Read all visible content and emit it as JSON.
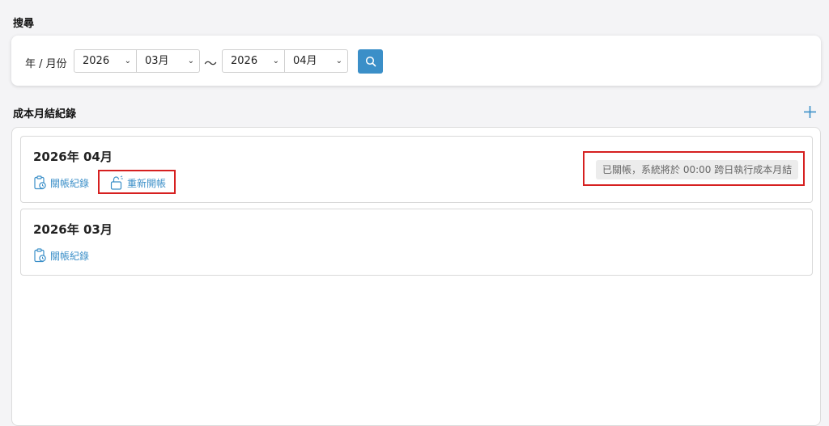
{
  "search": {
    "title": "搜尋",
    "label": "年 / 月份",
    "from_year": "2026",
    "from_month": "03月",
    "separator": "～",
    "to_year": "2026",
    "to_month": "04月"
  },
  "records": {
    "title": "成本月結紀錄",
    "items": [
      {
        "title": "2026年 04月",
        "log_label": "關帳紀錄",
        "reopen_label": "重新開帳",
        "status": "已關帳，系統將於 00:00 跨日執行成本月結"
      },
      {
        "title": "2026年 03月",
        "log_label": "關帳紀錄"
      }
    ]
  },
  "colors": {
    "accent": "#3b8fc8",
    "highlight": "#d62020"
  }
}
